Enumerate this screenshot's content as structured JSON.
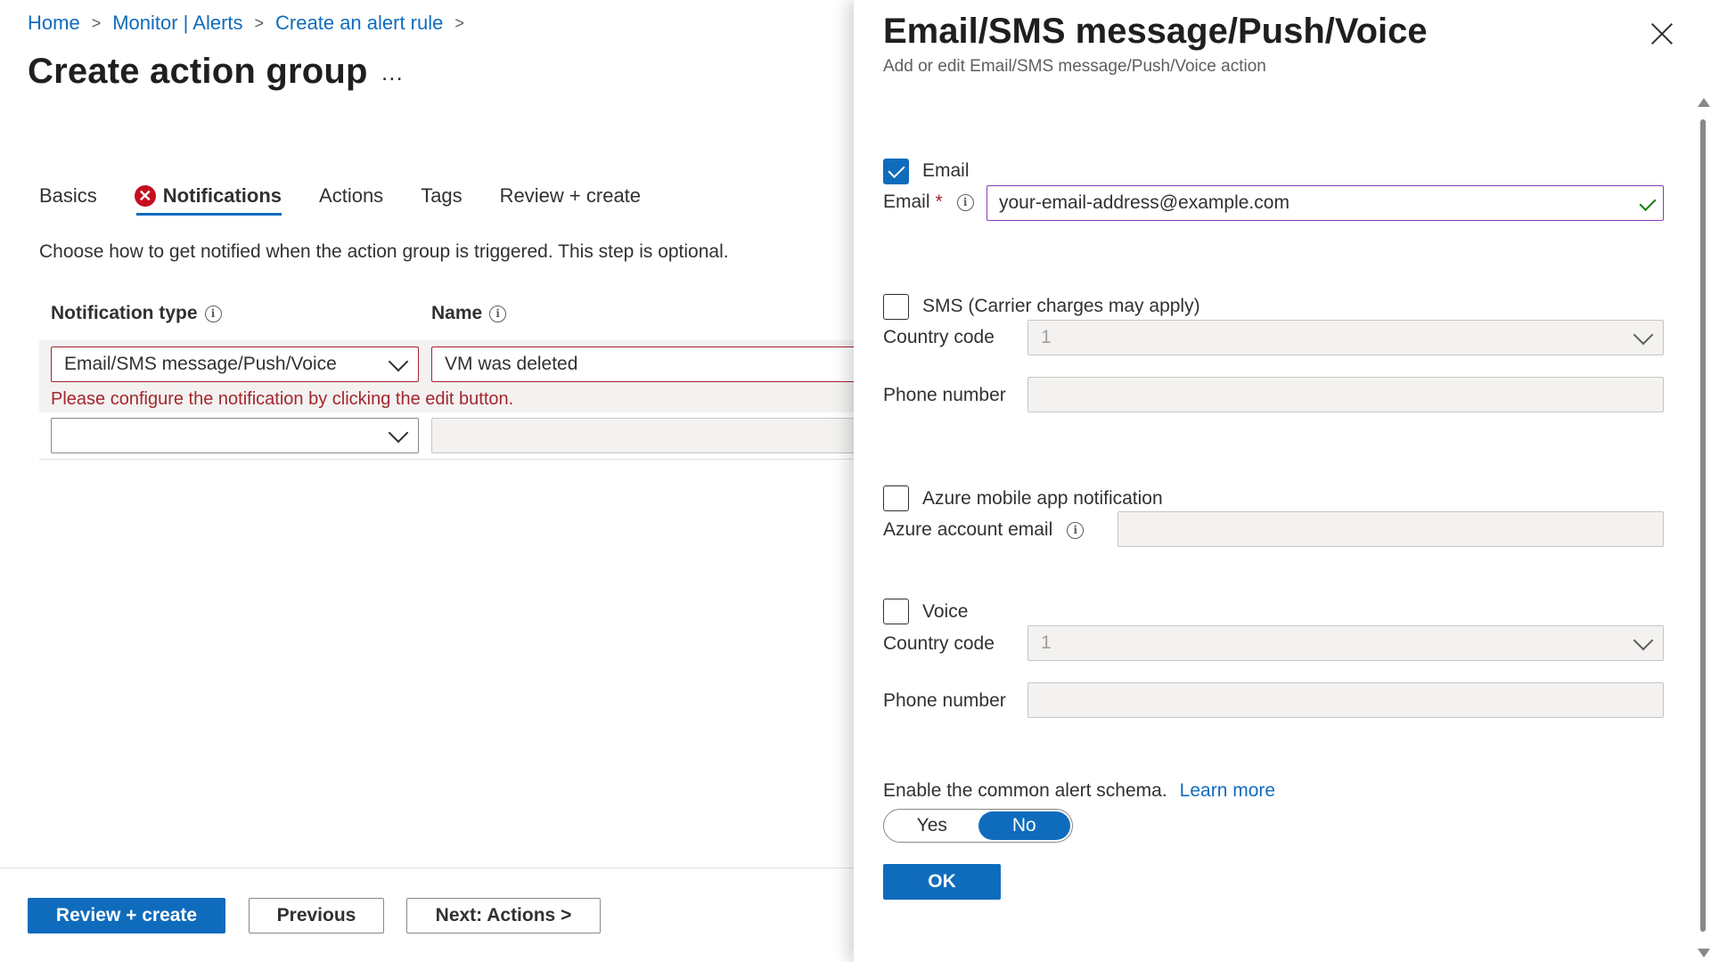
{
  "breadcrumb": {
    "items": [
      "Home",
      "Monitor | Alerts",
      "Create an alert rule"
    ],
    "separator": ">"
  },
  "page": {
    "title": "Create action group",
    "more": "...",
    "description": "Choose how to get notified when the action group is triggered. This step is optional."
  },
  "tabs": [
    {
      "label": "Basics",
      "active": false,
      "error": false
    },
    {
      "label": "Notifications",
      "active": true,
      "error": true
    },
    {
      "label": "Actions",
      "active": false,
      "error": false
    },
    {
      "label": "Tags",
      "active": false,
      "error": false
    },
    {
      "label": "Review + create",
      "active": false,
      "error": false
    }
  ],
  "table": {
    "headers": {
      "notification_type": "Notification type",
      "name": "Name"
    },
    "rows": [
      {
        "type": "Email/SMS message/Push/Voice",
        "name": "VM was deleted",
        "error": "Please configure the notification by clicking the edit button."
      },
      {
        "type": "",
        "name": ""
      }
    ]
  },
  "footer": {
    "review_create": "Review + create",
    "previous": "Previous",
    "next": "Next: Actions >"
  },
  "panel": {
    "title": "Email/SMS message/Push/Voice",
    "subtitle": "Add or edit Email/SMS message/Push/Voice action",
    "email": {
      "checkbox_label": "Email",
      "checked": true,
      "field_label": "Email",
      "required_mark": "*",
      "value": "your-email-address@example.com"
    },
    "sms": {
      "checkbox_label": "SMS (Carrier charges may apply)",
      "checked": false,
      "country_code_label": "Country code",
      "country_code_value": "1",
      "phone_label": "Phone number",
      "phone_value": ""
    },
    "push": {
      "checkbox_label": "Azure mobile app notification",
      "checked": false,
      "account_label": "Azure account email",
      "account_value": ""
    },
    "voice": {
      "checkbox_label": "Voice",
      "checked": false,
      "country_code_label": "Country code",
      "country_code_value": "1",
      "phone_label": "Phone number",
      "phone_value": ""
    },
    "schema": {
      "label": "Enable the common alert schema.",
      "learn_more": "Learn more",
      "options": [
        "Yes",
        "No"
      ],
      "selected": "No"
    },
    "ok": "OK"
  },
  "colors": {
    "accent": "#0f6cbd",
    "error": "#a4262c",
    "error_icon": "#c50f1f",
    "success": "#107c10"
  },
  "icons": {
    "info": "info-icon",
    "close": "close-icon",
    "chevron": "chevron-down-icon",
    "error": "error-circle-icon",
    "check": "checkmark-icon"
  }
}
